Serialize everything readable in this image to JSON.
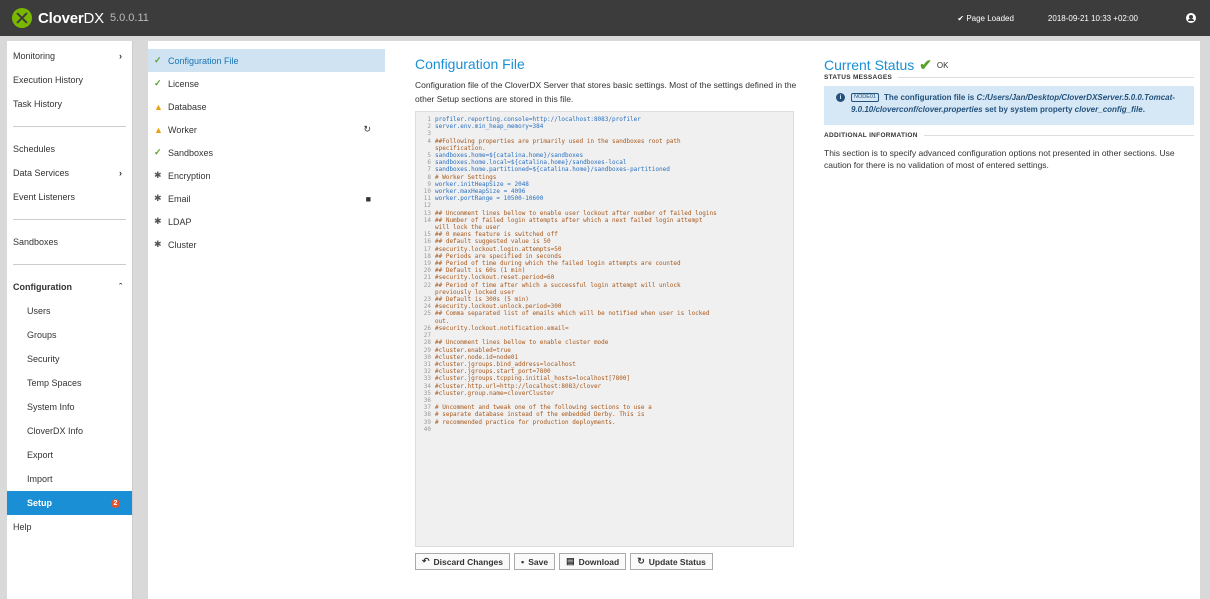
{
  "header": {
    "brand": "Clover",
    "brand_dx": "DX",
    "version": "5.0.0.11",
    "status": "✔ Page Loaded",
    "time": "2018-09-21 10:33 +02:00",
    "user_icon": "user-circle-icon"
  },
  "nav": {
    "monitoring": "Monitoring",
    "execution_history": "Execution History",
    "task_history": "Task History",
    "schedules": "Schedules",
    "data_services": "Data Services",
    "event_listeners": "Event Listeners",
    "sandboxes": "Sandboxes",
    "configuration": "Configuration",
    "users": "Users",
    "groups": "Groups",
    "security": "Security",
    "temp_spaces": "Temp Spaces",
    "system_info": "System Info",
    "cloverdx_info": "CloverDX Info",
    "export": "Export",
    "import": "Import",
    "setup": "Setup",
    "setup_badge": "2",
    "help": "Help"
  },
  "subnav": {
    "items": [
      {
        "label": "Configuration File",
        "icon": "check-icon"
      },
      {
        "label": "License",
        "icon": "check-icon"
      },
      {
        "label": "Database",
        "icon": "warning-icon"
      },
      {
        "label": "Worker",
        "icon": "warning-icon"
      },
      {
        "label": "Sandboxes",
        "icon": "check-icon"
      },
      {
        "label": "Encryption",
        "icon": "gear-icon"
      },
      {
        "label": "Email",
        "icon": "gear-icon"
      },
      {
        "label": "LDAP",
        "icon": "gear-icon"
      },
      {
        "label": "Cluster",
        "icon": "gear-icon"
      }
    ]
  },
  "main": {
    "title": "Configuration File",
    "description": "Configuration file of the CloverDX Server that stores basic settings. Most of the settings defined in the other Setup sections are stored in this file.",
    "code": [
      "profiler.reporting.console=http://localhost:8083/profiler",
      "server.env.min_heap_memory=384",
      "",
      "##Following properties are primarily used in the sandboxes root path",
      "specification.",
      "sandboxes.home=${catalina.home}/sandboxes",
      "sandboxes.home.local=${catalina.home}/sandboxes-local",
      "sandboxes.home.partitioned=${catalina.home}/sandboxes-partitioned",
      "# Worker Settings",
      "worker.initHeapSize = 2048",
      "worker.maxHeapSize = 4096",
      "worker.portRange = 10500-10600",
      "",
      "## Uncomment lines bellow to enable user lockout after number of failed logins",
      "## Number of failed login attempts after which a next failed login attempt",
      "will lock the user",
      "## 0 means feature is switched off",
      "## default suggested value is 50",
      "#security.lockout.login.attempts=50",
      "## Periods are specified in seconds",
      "## Period of time during which the failed login attempts are counted",
      "## Default is 60s (1 min)",
      "#security.lockout.reset.period=60",
      "## Period of time after which a successful login attempt will unlock",
      "previously locked user",
      "## Default is 300s (5 min)",
      "#security.lockout.unlock.period=300",
      "## Comma separated list of emails which will be notified when user is locked",
      "out.",
      "#security.lockout.notification.email=",
      "",
      "## Uncomment lines bellow to enable cluster mode",
      "#cluster.enabled=true",
      "#cluster.node.id=node01",
      "#cluster.jgroups.bind_address=localhost",
      "#cluster.jgroups.start_port=7800",
      "#cluster.jgroups.tcpping.initial_hosts=localhost[7800]",
      "#cluster.http.url=http://localhost:8083/clover",
      "#cluster.group.name=cloverCluster",
      "",
      "# Uncomment and tweak one of the following sections to use a",
      "# separate database instead of the embedded Derby. This is",
      "# recommended practice for production deployments.",
      ""
    ],
    "line_numbers": [
      "1",
      "2",
      "3",
      "4",
      "",
      "5",
      "6",
      "7",
      "8",
      "9",
      "10",
      "11",
      "12",
      "13",
      "14",
      "",
      "15",
      "16",
      "17",
      "18",
      "19",
      "20",
      "21",
      "22",
      "",
      "23",
      "24",
      "25",
      "",
      "26",
      "27",
      "28",
      "29",
      "30",
      "31",
      "32",
      "33",
      "34",
      "35",
      "36",
      "37",
      "38",
      "39",
      "40"
    ],
    "buttons": {
      "discard": "Discard Changes",
      "save": "Save",
      "download": "Download",
      "update": "Update Status"
    }
  },
  "status": {
    "title": "Current Status",
    "ok": "OK",
    "messages_label": "STATUS MESSAGES",
    "node_tag": "NODE01",
    "message_prefix": "The configuration file is ",
    "message_path": "C:/Users/Jan/Desktop/CloverDXServer.5.0.0.Tomcat-9.0.10/cloverconf/clover.properties",
    "message_mid": " set by system property ",
    "message_prop": "clover_config_file",
    "message_end": ".",
    "additional_label": "ADDITIONAL INFORMATION",
    "additional_text": "This section is to specify advanced configuration options not presented in other sections. Use caution for there is no validation of most of entered settings."
  }
}
